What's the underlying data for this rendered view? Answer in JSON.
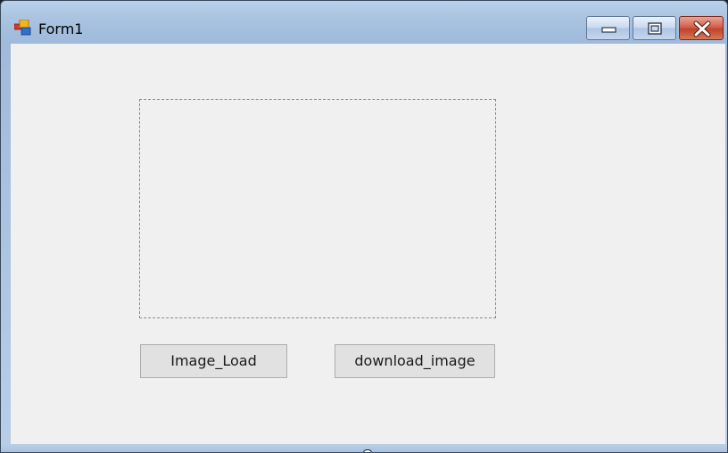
{
  "window": {
    "title": "Form1",
    "icon": "windows-forms-app-icon"
  },
  "caption_buttons": {
    "minimize_icon": "minimize-icon",
    "maximize_icon": "maximize-icon",
    "close_icon": "close-icon"
  },
  "form": {
    "picturebox_icon": "picturebox",
    "buttons": {
      "load_label": "Image_Load",
      "download_label": "download_image"
    }
  },
  "colors": {
    "titlebar": "#a9c3e0",
    "client_background": "#f0f0f0",
    "button_face": "#e1e1e1",
    "close_button": "#c1412a"
  }
}
